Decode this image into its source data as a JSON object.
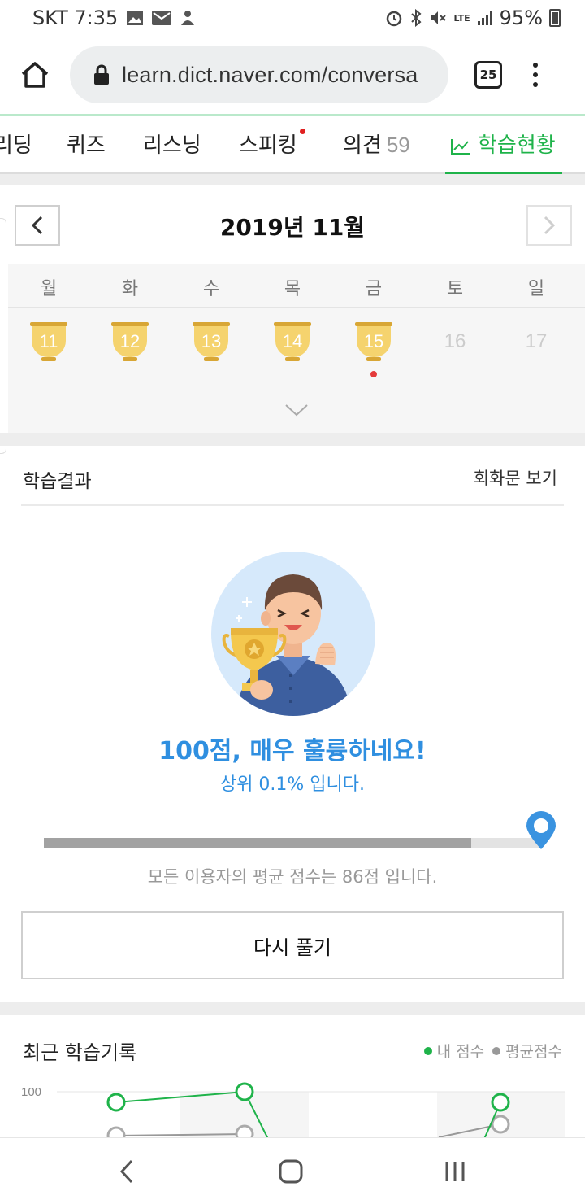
{
  "status_bar": {
    "carrier_time": "SKT 7:35",
    "network": "LTE",
    "battery": "95%"
  },
  "browser": {
    "url": "learn.dict.naver.com/conversa",
    "tab_count": "25"
  },
  "nav": {
    "tabs": [
      {
        "label": "리딩"
      },
      {
        "label": "퀴즈"
      },
      {
        "label": "리스닝"
      },
      {
        "label": "스피킹"
      },
      {
        "label": "의견",
        "count": "59"
      },
      {
        "label": "학습현황"
      }
    ],
    "active_color": "#1fb34a"
  },
  "calendar": {
    "title": "2019년 11월",
    "weekdays": [
      "월",
      "화",
      "수",
      "목",
      "금",
      "토",
      "일"
    ],
    "days": [
      {
        "date": "11",
        "completed": true
      },
      {
        "date": "12",
        "completed": true
      },
      {
        "date": "13",
        "completed": true
      },
      {
        "date": "14",
        "completed": true
      },
      {
        "date": "15",
        "completed": true
      },
      {
        "date": "16",
        "completed": false
      },
      {
        "date": "17",
        "completed": false
      }
    ]
  },
  "result": {
    "title": "학습결과",
    "view_link": "회화문 보기",
    "score_message": "100점, 매우 훌륭하네요!",
    "rank_message": "상위 0.1% 입니다.",
    "my_score": 100,
    "avg_score": 86,
    "avg_message": "모든 이용자의 평균 점수는 86점 입니다.",
    "retry_label": "다시 풀기",
    "accent_color": "#2f8fe0"
  },
  "history": {
    "title": "최근 학습기록",
    "legend": {
      "mine": "내 점수",
      "average": "평균점수"
    },
    "y_tick": "100",
    "mine_color": "#1fb34a",
    "avg_color": "#999999"
  }
}
